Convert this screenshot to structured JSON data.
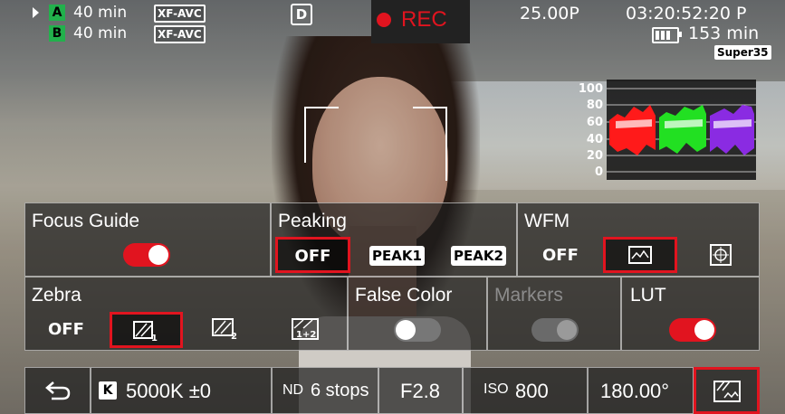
{
  "status": {
    "slot_a": {
      "label": "A",
      "remaining": "40 min",
      "format": "XF-AVC"
    },
    "slot_b": {
      "label": "B",
      "remaining": "40 min",
      "format": "XF-AVC"
    },
    "rec_label": "REC",
    "frame_rate": "25.00P",
    "timecode": "03:20:52:20 P",
    "battery": "153 min",
    "sensor_mode": "Super35",
    "drive_icon": "D"
  },
  "waveform": {
    "scale": [
      "100",
      "80",
      "60",
      "40",
      "20",
      "0"
    ],
    "channel_colors": [
      "#ff1a1a",
      "#22e022",
      "#8a2be2"
    ]
  },
  "focus_guide": {
    "title": "Focus Guide",
    "state": "on"
  },
  "peaking": {
    "title": "Peaking",
    "options": [
      "OFF",
      "PEAK1",
      "PEAK2"
    ],
    "selected": "OFF"
  },
  "wfm": {
    "title": "WFM",
    "options": [
      "OFF",
      "waveform-icon",
      "vectorscope-icon"
    ],
    "selected": "waveform-icon",
    "off_label": "OFF"
  },
  "zebra": {
    "title": "Zebra",
    "off_label": "OFF",
    "options": [
      "1",
      "2",
      "1+2"
    ],
    "selected": "1"
  },
  "false_color": {
    "title": "False Color",
    "state": "off"
  },
  "markers": {
    "title": "Markers",
    "state": "disabled"
  },
  "lut": {
    "title": "LUT",
    "state": "on"
  },
  "bottom": {
    "back_icon": "back-arrow-icon",
    "wb_badge": "K",
    "white_balance": "5000K ±0",
    "nd_label": "ND",
    "nd_value": "6 stops",
    "aperture": "F2.8",
    "iso_label": "ISO",
    "iso_value": "800",
    "shutter": "180.00°",
    "assist_icon": "assist-display-icon"
  },
  "colors": {
    "accent": "#e1141f",
    "green": "#22b14c"
  }
}
